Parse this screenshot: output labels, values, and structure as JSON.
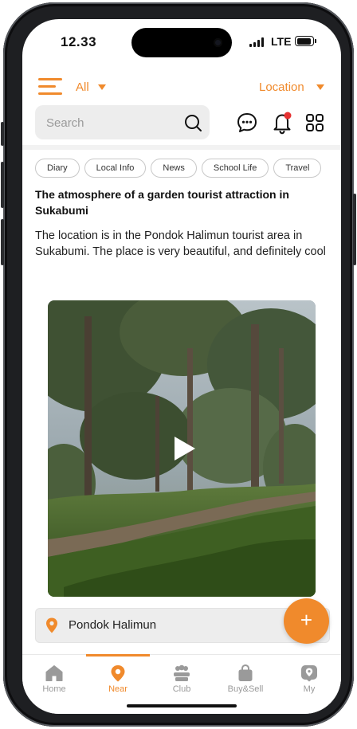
{
  "status_bar": {
    "time": "12.33",
    "network": "LTE"
  },
  "header": {
    "filter_label": "All",
    "location_label": "Location"
  },
  "search": {
    "placeholder": "Search"
  },
  "categories": [
    "Diary",
    "Local Info",
    "News",
    "School Life",
    "Travel"
  ],
  "post": {
    "title": "The atmosphere of a garden tourist attraction in Sukabumi",
    "body": "The location is in the Pondok Halimun tourist area in Sukabumi. The place is very beautiful, and definitely cool",
    "location": "Pondok Halimun"
  },
  "fab": {
    "label": "+"
  },
  "tabs": [
    {
      "label": "Home",
      "icon": "home-icon"
    },
    {
      "label": "Near",
      "icon": "location-pin-icon",
      "active": true
    },
    {
      "label": "Club",
      "icon": "club-icon"
    },
    {
      "label": "Buy&Sell",
      "icon": "shopping-bag-icon"
    },
    {
      "label": "My",
      "icon": "profile-icon"
    }
  ],
  "colors": {
    "accent": "#f08a2c",
    "inactive": "#9a9a9a",
    "chip_border": "#c8c8c8"
  }
}
